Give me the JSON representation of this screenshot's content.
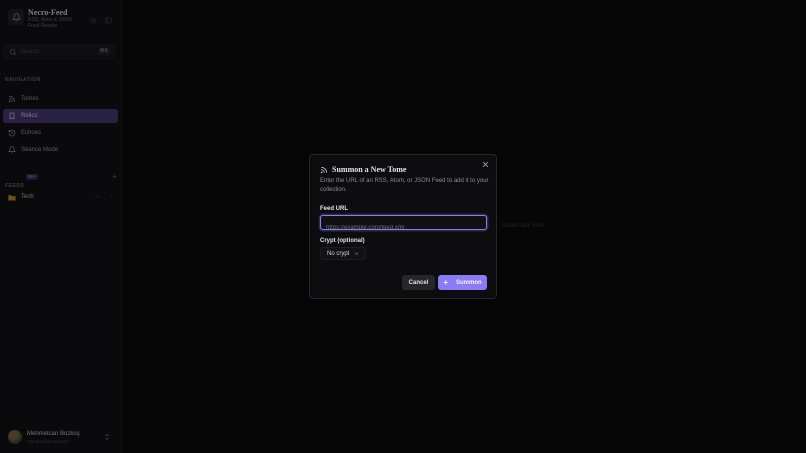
{
  "brand": {
    "name": "Necro-Feed",
    "subtitle": "RSS, Atom & JSON Feed Reader"
  },
  "search": {
    "placeholder": "Search...",
    "shortcut": "⌘K"
  },
  "navigation": {
    "label": "NAVIGATION",
    "items": [
      {
        "label": "Tomes",
        "icon": "rss-icon",
        "active": false
      },
      {
        "label": "Relics",
        "icon": "bookmark-icon",
        "active": true
      },
      {
        "label": "Echoes",
        "icon": "history-icon",
        "active": false
      },
      {
        "label": "Séance Mode",
        "icon": "bell-icon",
        "active": false
      }
    ]
  },
  "feeds": {
    "label": "FEEDS",
    "badge": "99+",
    "folders": [
      {
        "name": "Tech",
        "count": "99+"
      }
    ]
  },
  "user": {
    "name": "Mehmetcan Bozkuş",
    "email": "mb.mbo@gmail.com"
  },
  "main": {
    "empty_hint": "bookmark icon."
  },
  "modal": {
    "title": "Summon a New Tome",
    "description": "Enter the URL of an RSS, Atom, or JSON Feed to add it to your collection.",
    "feed_url_label": "Feed URL",
    "feed_url_placeholder": "https://example.com/feed.xml",
    "crypt_label": "Crypt (optional)",
    "crypt_value": "No crypt",
    "cancel_label": "Cancel",
    "summon_label": "Summon"
  },
  "colors": {
    "accent": "#8b7cf6",
    "active_nav": "#4a3d7a",
    "background": "#09090b"
  }
}
